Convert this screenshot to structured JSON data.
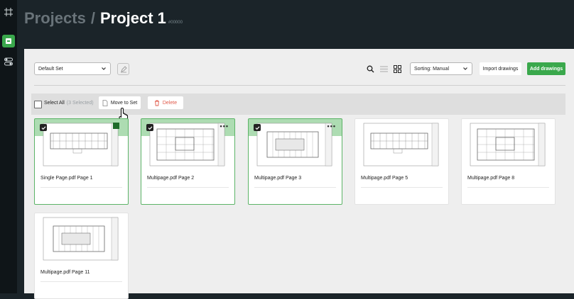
{
  "header": {
    "breadcrumb_parent": "Projects",
    "breadcrumb_separator": "/",
    "breadcrumb_current": "Project 1",
    "project_id": "#00000"
  },
  "toolbar": {
    "set_select": "Default Set",
    "sorting_select": "Sorting: Manual",
    "import_label": "Import drawings",
    "add_label": "Add drawings"
  },
  "selection": {
    "select_all_label": "Select All",
    "selected_count": "(3 Selected)",
    "move_label": "Move to Set",
    "delete_label": "Delete"
  },
  "drawings": [
    {
      "name": "Single Page.pdf Page 1",
      "selected": true
    },
    {
      "name": "Multipage.pdf Page 2",
      "selected": true
    },
    {
      "name": "Multipage.pdf Page 3",
      "selected": true
    },
    {
      "name": "Multipage.pdf Page 5",
      "selected": false
    },
    {
      "name": "Multipage.pdf Page 8",
      "selected": false
    },
    {
      "name": "Multipage.pdf Page 11",
      "selected": false
    }
  ],
  "icons": {
    "rail": [
      "frame-icon",
      "document-icon",
      "toggle-icon"
    ],
    "toolbar": [
      "edit-set-icon",
      "search-icon",
      "list-view-icon",
      "grid-view-icon"
    ],
    "selection": [
      "move-to-set-icon",
      "delete-icon",
      "pointer-cursor-icon"
    ]
  },
  "colors": {
    "accent": "#3aa84c",
    "selected_tint": "#6ac072",
    "danger": "#e05a4a",
    "sidebar_bg": "#0f1518",
    "header_bg": "#1b2429",
    "panel_bg": "#eeeeee"
  }
}
